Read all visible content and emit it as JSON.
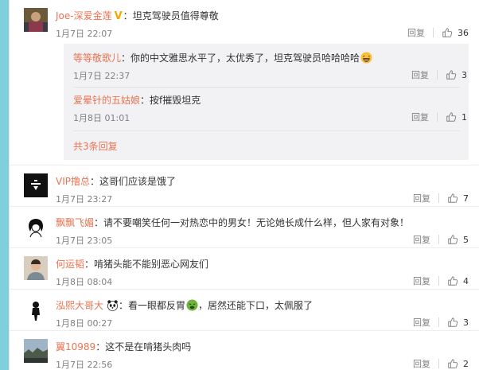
{
  "comments": [
    {
      "username": "Joe-深爱金莲",
      "verified_badge": "V",
      "text": "坦克驾驶员值得尊敬",
      "time": "1月7日 22:07",
      "reply_label": "回复",
      "likes": "36",
      "replies": [
        {
          "username": "等等敬歌儿",
          "text": "你的中文雅思水平了，太优秀了，坦克驾驶员哈哈哈哈",
          "time": "1月7日 22:37",
          "reply_label": "回复",
          "likes": "3"
        },
        {
          "username": "爱晕针的五姑娘",
          "text": "按f摧毁坦克",
          "time": "1月8日 01:01",
          "reply_label": "回复",
          "likes": "1"
        }
      ],
      "more_replies": "共3条回复"
    },
    {
      "username": "VIP撸总",
      "text": "这哥们应该是饿了",
      "time": "1月7日 23:27",
      "reply_label": "回复",
      "likes": "7"
    },
    {
      "username": "飘飘飞媚",
      "text": "请不要嘲笑任何一对热恋中的男女！无论她长成什么样，但人家有对象！",
      "time": "1月7日 23:05",
      "reply_label": "回复",
      "likes": "5"
    },
    {
      "username": "何运韬",
      "text": "啃猪头能不能别恶心网友们",
      "time": "1月8日 08:04",
      "reply_label": "回复",
      "likes": "4"
    },
    {
      "username": "泓熙大哥大",
      "text_before": "看一眼都反胃",
      "text_after": "，居然还能下口，太佩服了",
      "time": "1月8日 00:27",
      "reply_label": "回复",
      "likes": "3"
    },
    {
      "username": "翼10989",
      "text": "这不是在啃猪头肉吗",
      "time": "1月7日 22:56",
      "reply_label": "回复",
      "likes": "2"
    }
  ],
  "colors": {
    "username": "#eb7350",
    "accent_bar": "#80cfdc",
    "verified": "#f7a800"
  }
}
